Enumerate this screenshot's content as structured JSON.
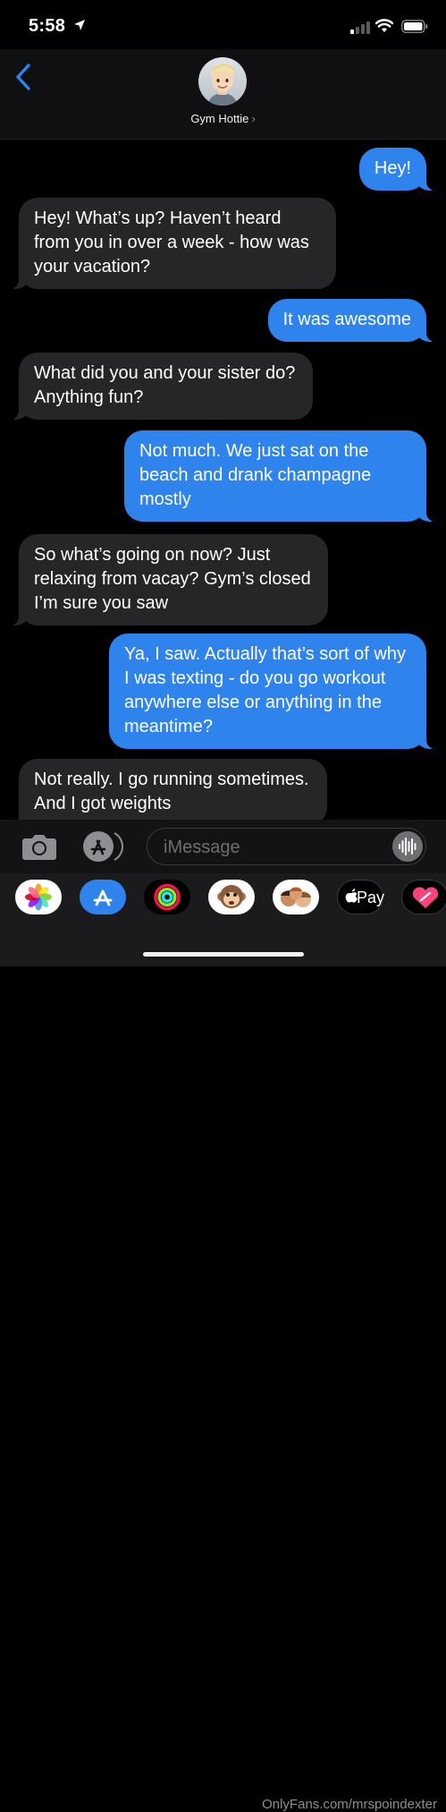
{
  "status_bar": {
    "time": "5:58",
    "icons": [
      "location-arrow-icon",
      "cellular-signal-icon",
      "wifi-icon",
      "battery-icon"
    ]
  },
  "header": {
    "back_icon": "chevron-left-icon",
    "contact_name": "Gym Hottie",
    "contact_chevron": "›"
  },
  "messages": [
    {
      "direction": "sent",
      "text": "Hey!"
    },
    {
      "direction": "received",
      "text": "Hey!  What’s up?  Haven’t heard from you in over a week - how was your vacation?"
    },
    {
      "direction": "sent",
      "text": "It was awesome"
    },
    {
      "direction": "received",
      "text": "What did you and your sister do?  Anything fun?"
    },
    {
      "direction": "sent",
      "text": "Not much.  We just sat on the beach and drank champagne mostly"
    },
    {
      "direction": "received",
      "text": "So what’s going on now?  Just relaxing from vacay?  Gym’s closed I’m sure you saw"
    },
    {
      "direction": "sent",
      "text": "Ya, I saw.  Actually that’s sort of why I was texting - do you go workout anywhere else or anything in the meantime?"
    },
    {
      "direction": "received",
      "text": "Not really.  I go running sometimes.  And I got weights"
    }
  ],
  "compose": {
    "placeholder": "iMessage",
    "icons": [
      "camera-icon",
      "app-store-icon",
      "audio-waveform-icon"
    ]
  },
  "app_drawer": {
    "apps": [
      "photos-icon",
      "app-store-icon",
      "activity-icon",
      "animoji-icon",
      "memoji-stickers-icon",
      "apple-pay-icon",
      "digital-touch-icon"
    ],
    "apple_pay_label": "Pay"
  },
  "watermark": "OnlyFans.com/mrspoindexter",
  "colors": {
    "sent_bubble": "#2f83ec",
    "received_bubble": "#262628",
    "accent": "#2f83ec"
  }
}
